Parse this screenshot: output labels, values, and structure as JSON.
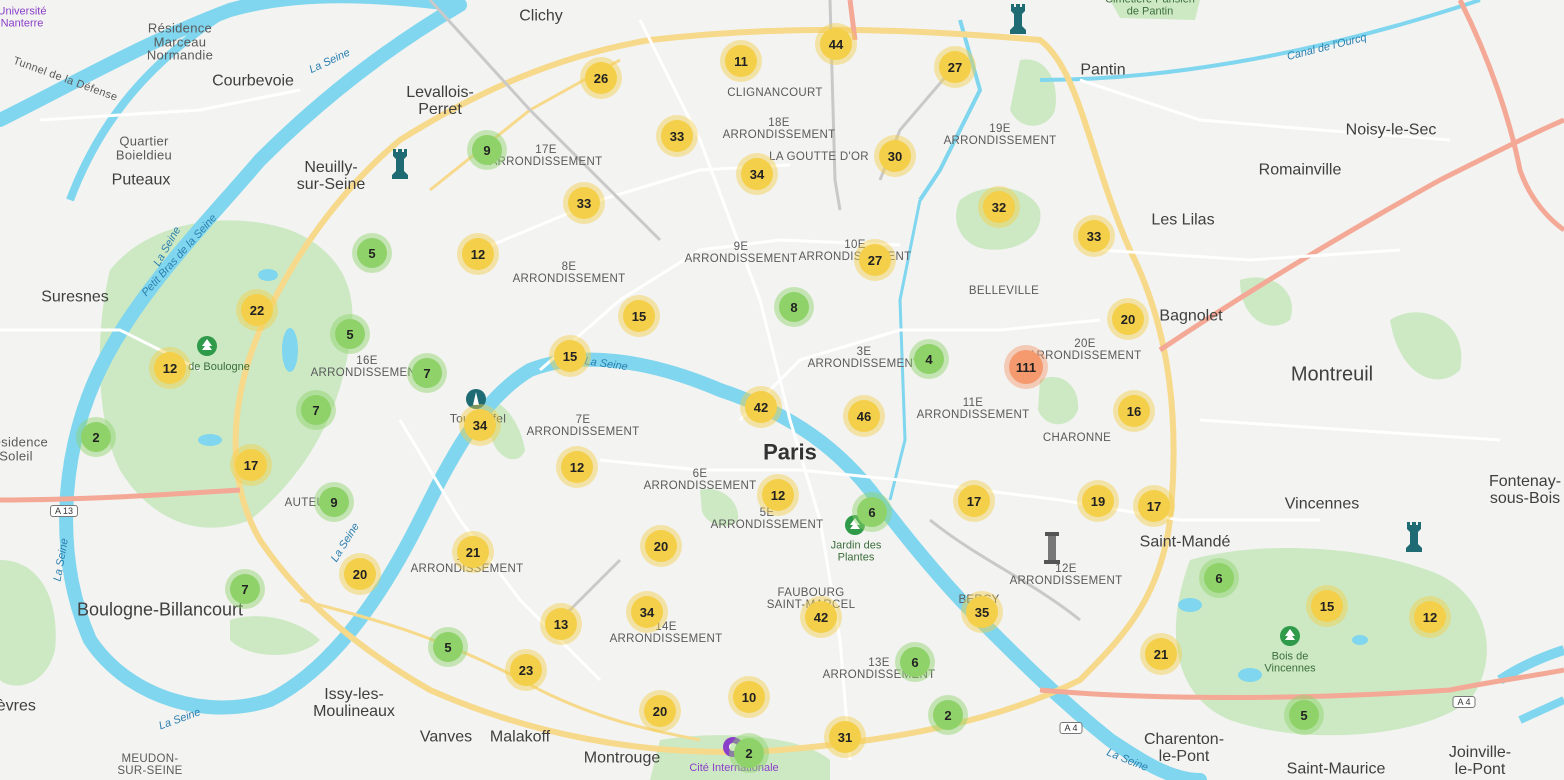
{
  "colors": {
    "green_cluster": "#8fd26a",
    "yellow_cluster": "#f4cf4a",
    "orange_cluster": "#f59a6e",
    "water": "#7fd6ee",
    "park": "#cde9c4",
    "highway": "#f4a896",
    "main_road": "#f6d98a"
  },
  "labels": {
    "universite_nanterre": "Université\nNanterre",
    "residence_marceau": "Résidence\nMarceau\nNormandie",
    "clichy": "Clichy",
    "cimetiere_pantin": "Cimetière Parisien\nde Pantin",
    "pantin": "Pantin",
    "canal_ourcq": "Canal de l'Ourcq",
    "courbevoie": "Courbevoie",
    "levallois": "Levallois-\nPerret",
    "clignancourt": "CLIGNANCOURT",
    "arr18": "18E\nARRONDISSEMENT",
    "goutte_dor": "LA GOUTTE D'OR",
    "arr19": "19E\nARRONDISSEMENT",
    "noisy": "Noisy-le-Sec",
    "tunnel_defense": "Tunnel de la Défense",
    "quartier_boieldieu": "Quartier\nBoieldieu",
    "neuilly": "Neuilly-\nsur-Seine",
    "arr17": "17E\nARRONDISSEMENT",
    "romainville": "Romainville",
    "puteaux": "Puteaux",
    "les_lilas": "Les Lilas",
    "la_seine": "La Seine",
    "petit_bras": "Petit Bras de la Seine",
    "arr9": "9E\nARRONDISSEMENT",
    "arr10": "10E\nARRONDISSEMENT",
    "arr8": "8E\nARRONDISSEMENT",
    "belleville": "BELLEVILLE",
    "suresnes": "Suresnes",
    "bagnolet": "Bagnolet",
    "bois_boulogne": "de Boulogne",
    "arr16": "16E\nARRONDISSEMENT",
    "arr3": "3E\nARRONDISSEMENT",
    "arr20": "20E\nARRONDISSEMENT",
    "montreuil": "Montreuil",
    "tour_eiffel": "Tour Eiffel",
    "arr11": "11E\nARRONDISSEMENT",
    "residence_soleil": "Résidence\nSoleil",
    "arr7": "7E\nARRONDISSEMENT",
    "charonne": "CHARONNE",
    "paris": "Paris",
    "arr6": "6E\nARRONDISSEMENT",
    "fontenay": "Fontenay-\nsous-Bois",
    "auteuil": "AUTEUIL",
    "arr5": "5E\nARRONDISSEMENT",
    "vincennes": "Vincennes",
    "jardin_plantes": "Jardin des\nPlantes",
    "saint_mande": "Saint-Mandé",
    "arr15": "15E\nARRONDISSEMENT",
    "arr12": "12E\nARRONDISSEMENT",
    "boulogne": "Boulogne-Billancourt",
    "faubourg": "FAUBOURG\nSAINT-MARCEL",
    "bercy": "BERCY",
    "arr14": "14E\nARRONDISSEMENT",
    "bois_vincennes": "Bois de\nVincennes",
    "arr13": "13E\nARRONDISSEMENT",
    "issy": "Issy-les-\nMoulineaux",
    "sevres": "Sèvres",
    "vanves": "Vanves",
    "malakoff": "Malakoff",
    "charenton": "Charenton-\nle-Pont",
    "montrouge": "Montrouge",
    "joinville": "Joinville-\nle-Pont",
    "meudon": "MEUDON-\nSUR-SEINE",
    "cite_internationale": "Cité Internationale",
    "saint_maurice": "Saint-Maurice"
  },
  "shields": {
    "a13": "A 13",
    "a4_left": "A 4",
    "a4_right": "A 4"
  },
  "clusters": [
    {
      "id": "c1",
      "count": "44",
      "level": "yellow"
    },
    {
      "id": "c2",
      "count": "11",
      "level": "yellow"
    },
    {
      "id": "c3",
      "count": "26",
      "level": "yellow"
    },
    {
      "id": "c4",
      "count": "27",
      "level": "yellow"
    },
    {
      "id": "c5",
      "count": "33",
      "level": "yellow"
    },
    {
      "id": "c6",
      "count": "9",
      "level": "green"
    },
    {
      "id": "c7",
      "count": "30",
      "level": "yellow"
    },
    {
      "id": "c8",
      "count": "34",
      "level": "yellow"
    },
    {
      "id": "c9",
      "count": "33",
      "level": "yellow"
    },
    {
      "id": "c10",
      "count": "32",
      "level": "yellow"
    },
    {
      "id": "c11",
      "count": "33",
      "level": "yellow"
    },
    {
      "id": "c12",
      "count": "5",
      "level": "green"
    },
    {
      "id": "c13",
      "count": "12",
      "level": "yellow"
    },
    {
      "id": "c14",
      "count": "27",
      "level": "yellow"
    },
    {
      "id": "c15",
      "count": "22",
      "level": "yellow"
    },
    {
      "id": "c16",
      "count": "8",
      "level": "green"
    },
    {
      "id": "c17",
      "count": "5",
      "level": "green"
    },
    {
      "id": "c18",
      "count": "15",
      "level": "yellow"
    },
    {
      "id": "c19",
      "count": "20",
      "level": "yellow"
    },
    {
      "id": "c20",
      "count": "12",
      "level": "yellow"
    },
    {
      "id": "c21",
      "count": "15",
      "level": "yellow"
    },
    {
      "id": "c22",
      "count": "7",
      "level": "green"
    },
    {
      "id": "c23",
      "count": "4",
      "level": "green"
    },
    {
      "id": "c24",
      "count": "111",
      "level": "orange"
    },
    {
      "id": "c25",
      "count": "7",
      "level": "green"
    },
    {
      "id": "c26",
      "count": "42",
      "level": "yellow"
    },
    {
      "id": "c27",
      "count": "46",
      "level": "yellow"
    },
    {
      "id": "c28",
      "count": "16",
      "level": "yellow"
    },
    {
      "id": "c29",
      "count": "34",
      "level": "yellow"
    },
    {
      "id": "c30",
      "count": "2",
      "level": "green"
    },
    {
      "id": "c31",
      "count": "17",
      "level": "yellow"
    },
    {
      "id": "c32",
      "count": "12",
      "level": "yellow"
    },
    {
      "id": "c33",
      "count": "9",
      "level": "green"
    },
    {
      "id": "c34",
      "count": "12",
      "level": "yellow"
    },
    {
      "id": "c35",
      "count": "17",
      "level": "yellow"
    },
    {
      "id": "c36",
      "count": "19",
      "level": "yellow"
    },
    {
      "id": "c37",
      "count": "17",
      "level": "yellow"
    },
    {
      "id": "c38",
      "count": "6",
      "level": "green"
    },
    {
      "id": "c39",
      "count": "21",
      "level": "yellow"
    },
    {
      "id": "c40",
      "count": "20",
      "level": "yellow"
    },
    {
      "id": "c41",
      "count": "20",
      "level": "yellow"
    },
    {
      "id": "c42",
      "count": "6",
      "level": "green"
    },
    {
      "id": "c43",
      "count": "7",
      "level": "green"
    },
    {
      "id": "c44",
      "count": "34",
      "level": "yellow"
    },
    {
      "id": "c45",
      "count": "42",
      "level": "yellow"
    },
    {
      "id": "c46",
      "count": "35",
      "level": "yellow"
    },
    {
      "id": "c47",
      "count": "15",
      "level": "yellow"
    },
    {
      "id": "c48",
      "count": "12",
      "level": "yellow"
    },
    {
      "id": "c49",
      "count": "13",
      "level": "yellow"
    },
    {
      "id": "c50",
      "count": "5",
      "level": "green"
    },
    {
      "id": "c51",
      "count": "23",
      "level": "yellow"
    },
    {
      "id": "c52",
      "count": "6",
      "level": "green"
    },
    {
      "id": "c53",
      "count": "21",
      "level": "yellow"
    },
    {
      "id": "c54",
      "count": "10",
      "level": "yellow"
    },
    {
      "id": "c55",
      "count": "20",
      "level": "yellow"
    },
    {
      "id": "c56",
      "count": "2",
      "level": "green"
    },
    {
      "id": "c57",
      "count": "5",
      "level": "green"
    },
    {
      "id": "c58",
      "count": "31",
      "level": "yellow"
    },
    {
      "id": "c59",
      "count": "2",
      "level": "green"
    }
  ],
  "pois": [
    {
      "id": "p1",
      "icon": "chess-tower-icon"
    },
    {
      "id": "p2",
      "icon": "chess-tower-icon"
    },
    {
      "id": "p3",
      "icon": "chess-tower-icon"
    },
    {
      "id": "p4",
      "icon": "eiffel-tower-icon"
    },
    {
      "id": "p5",
      "icon": "column-monument-icon"
    },
    {
      "id": "p6",
      "icon": "park-tree-icon"
    },
    {
      "id": "p7",
      "icon": "park-tree-icon"
    },
    {
      "id": "p8",
      "icon": "park-tree-icon"
    },
    {
      "id": "p9",
      "icon": "campus-icon"
    }
  ]
}
